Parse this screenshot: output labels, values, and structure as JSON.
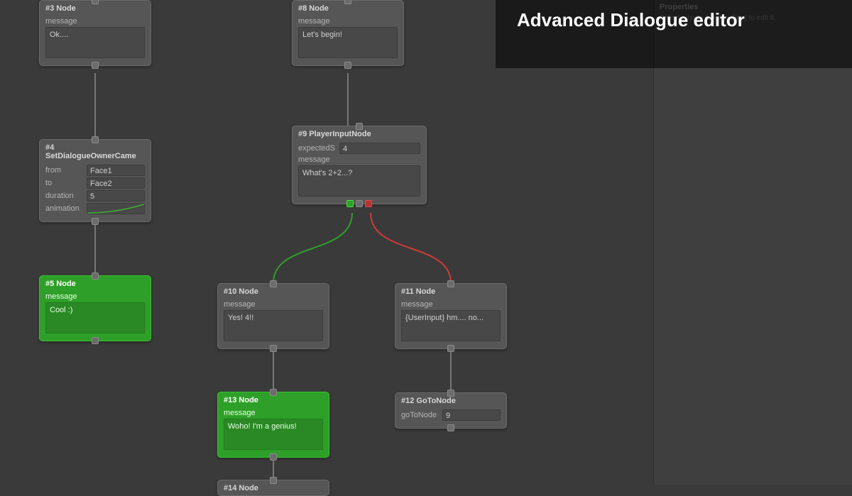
{
  "app": {
    "title": "Advanced Dialogue editor"
  },
  "properties": {
    "header": "Properties",
    "hint": "Select a node or edge (line) to edit it."
  },
  "nodes": {
    "n3": {
      "title": "#3 Node",
      "msg_label": "message",
      "msg": "Ok...."
    },
    "n4": {
      "title": "#4 SetDialogueOwnerCame",
      "from_label": "from",
      "from": "Face1",
      "to_label": "to",
      "to": "Face2",
      "dur_label": "duration",
      "dur": "5",
      "anim_label": "animation"
    },
    "n5": {
      "title": "#5 Node",
      "msg_label": "message",
      "msg": "Cool :)"
    },
    "n8": {
      "title": "#8 Node",
      "msg_label": "message",
      "msg": "Let's begin!"
    },
    "n9": {
      "title": "#9 PlayerInputNode",
      "exp_label": "expectedS",
      "exp": "4",
      "msg_label": "message",
      "msg": "What's 2+2...?"
    },
    "n10": {
      "title": "#10 Node",
      "msg_label": "message",
      "msg": "Yes! 4!!"
    },
    "n11": {
      "title": "#11 Node",
      "msg_label": "message",
      "msg": "{UserInput} hm.... no..."
    },
    "n12": {
      "title": "#12 GoToNode",
      "goto_label": "goToNode",
      "goto": "9"
    },
    "n13": {
      "title": "#13 Node",
      "msg_label": "message",
      "msg": "Woho! I'm a genius!"
    },
    "n14": {
      "title": "#14 Node"
    }
  }
}
